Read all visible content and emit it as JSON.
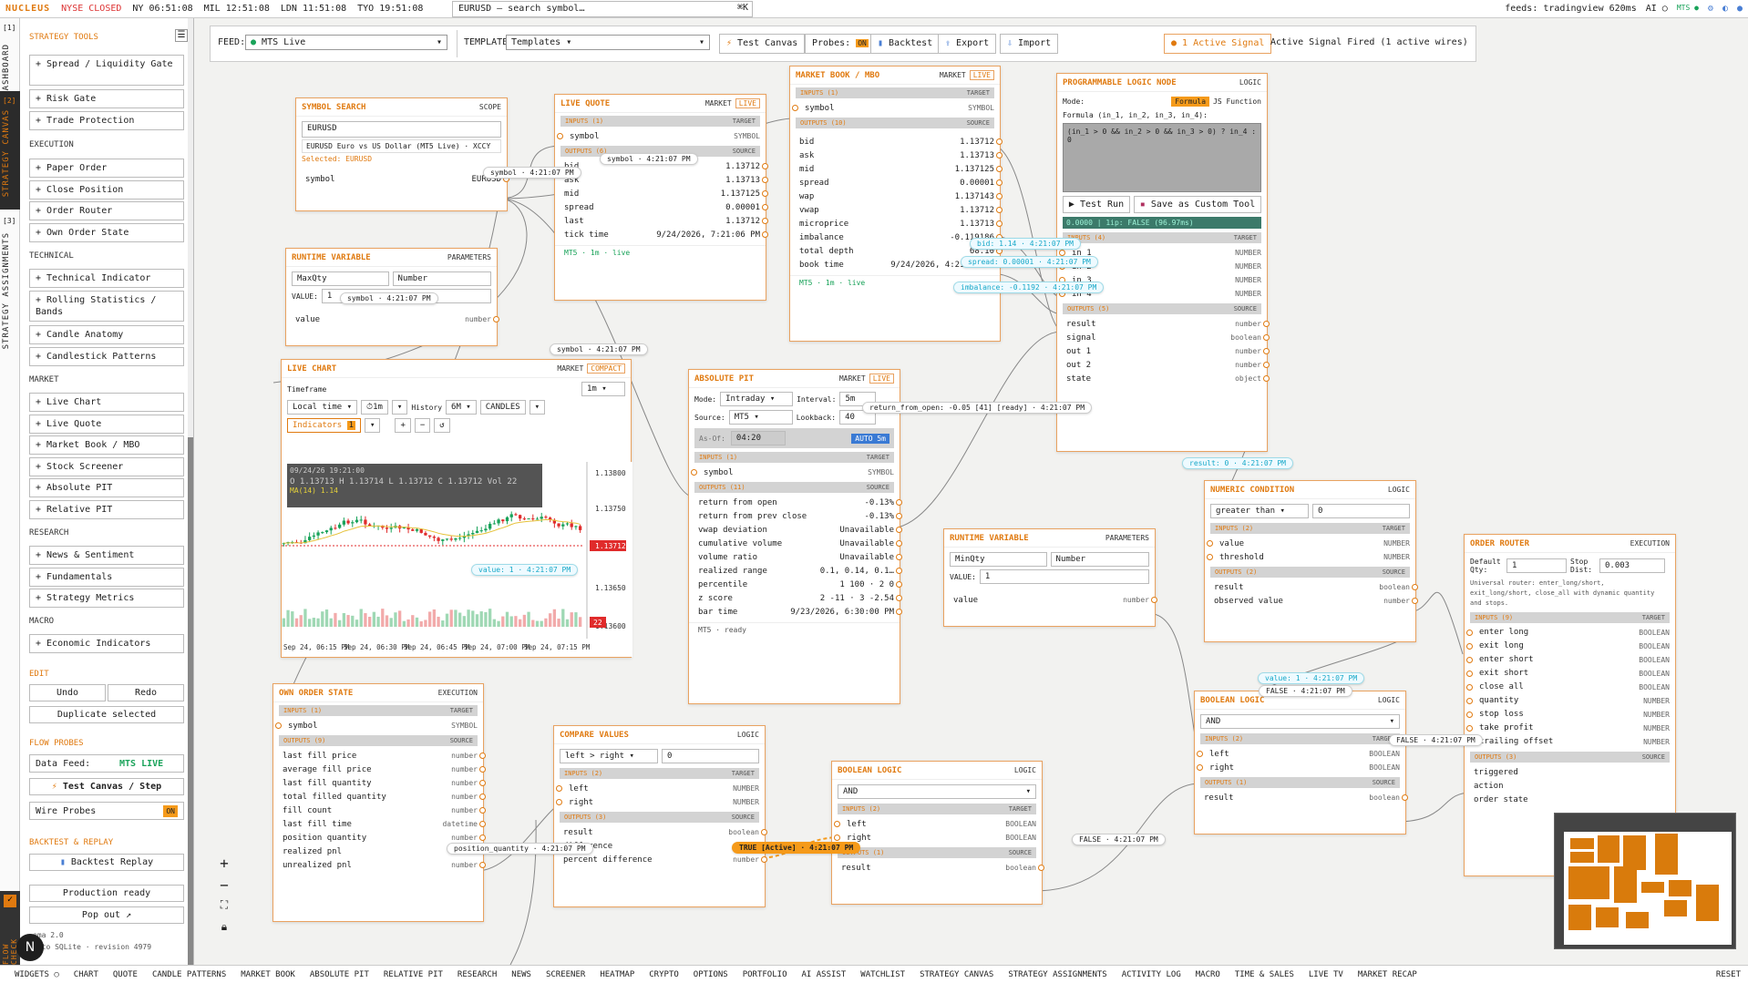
{
  "topbar": {
    "brand": "NUCLEUS",
    "market": "NYSE CLOSED",
    "ny": "NY 06:51:08",
    "mil": "MIL 12:51:08",
    "ldn": "LDN 11:51:08",
    "tyo": "TYO 19:51:08",
    "search": "EURUSD — search symbol…",
    "shortcut": "⌘K",
    "feeds": "feeds: tradingview 620ms",
    "ai": "AI ○",
    "mts": "MTS ●"
  },
  "rail": {
    "n1": "[1]",
    "dashboard": "DASHBOARD",
    "n2": "[2]",
    "canvas": "STRATEGY CANVAS",
    "n3": "[3]",
    "assign": "STRATEGY ASSIGNMENTS",
    "flow": "FLOW CHECK"
  },
  "sidebar": {
    "header": "STRATEGY TOOLS",
    "strategy": [
      "+ Spread / Liquidity Gate",
      "+ Risk Gate",
      "+ Trade Protection"
    ],
    "execution_title": "EXECUTION",
    "execution": [
      "+ Paper Order",
      "+ Close Position",
      "+ Order Router",
      "+ Own Order State"
    ],
    "technical_title": "TECHNICAL",
    "technical": [
      "+ Technical Indicator",
      "+ Rolling Statistics / Bands",
      "+ Candle Anatomy",
      "+ Candlestick Patterns"
    ],
    "market_title": "MARKET",
    "market": [
      "+ Live Chart",
      "+ Live Quote",
      "+ Market Book / MBO",
      "+ Stock Screener",
      "+ Absolute PIT",
      "+ Relative PIT"
    ],
    "research_title": "RESEARCH",
    "research": [
      "+ News & Sentiment",
      "+ Fundamentals",
      "+ Strategy Metrics"
    ],
    "macro_title": "MACRO",
    "macro": [
      "+ Economic Indicators"
    ],
    "edit_title": "EDIT",
    "undo": "Undo",
    "redo": "Redo",
    "dup": "Duplicate selected",
    "probes_title": "FLOW PROBES",
    "data_feed": "Data Feed:",
    "data_feed_val": "MTS LIVE",
    "test": "Test Canvas / Step",
    "wire": "Wire Probes",
    "wire_val": "ON",
    "bt_title": "BACKTEST & REPLAY",
    "bt": "Backtest Replay",
    "prod": "Production ready",
    "pop": "Pop out ↗",
    "schema": "ema 2.0",
    "saved": "d to SQLite · revision 4979"
  },
  "toolbar": {
    "feed_label": "FEED:",
    "feed": "MTS Live",
    "template_label": "TEMPLATE:",
    "template": "Templates ▾",
    "test": "Test Canvas",
    "probes": "Probes:",
    "probes_val": "ON",
    "backtest": "Backtest",
    "export": "Export",
    "import": "Import",
    "signal": "1 Active Signal",
    "signal_text": "Active Signal Fired (1 active wires)"
  },
  "symbol_search": {
    "title": "SYMBOL SEARCH",
    "cat": "SCOPE",
    "input": "EURUSD",
    "result": "EURUSD Euro vs US Dollar (MT5 Live) · XCCY",
    "selected": "Selected: EURUSD",
    "row_l": "symbol",
    "row_r": "EURUSD"
  },
  "rv1": {
    "title": "RUNTIME VARIABLE",
    "cat": "PARAMETERS",
    "name": "MaxQty",
    "type": "Number",
    "value_lbl": "VALUE:",
    "value": "1",
    "row": "value",
    "rtype": "number"
  },
  "live_quote": {
    "title": "LIVE QUOTE",
    "cat": "MARKET",
    "badge": "LIVE",
    "inputs": "INPUTS (1)",
    "target": "TARGET",
    "in_sym": "symbol",
    "in_t": "SYMBOL",
    "outputs": "OUTPUTS (6)",
    "source": "SOURCE",
    "rows": [
      [
        "bid",
        "1.13712"
      ],
      [
        "ask",
        "1.13713"
      ],
      [
        "mid",
        "1.137125"
      ],
      [
        "spread",
        "0.00001"
      ],
      [
        "last",
        "1.13712"
      ],
      [
        "tick time",
        "9/24/2026, 7:21:06 PM"
      ]
    ],
    "foot": "MT5 · 1m · live"
  },
  "book": {
    "title": "MARKET BOOK / MBO",
    "cat": "MARKET",
    "badge": "LIVE",
    "inputs": "INPUTS (1)",
    "in_sym": "symbol",
    "in_t": "SYMBOL",
    "outputs": "OUTPUTS (10)",
    "rows": [
      [
        "bid",
        "1.13712"
      ],
      [
        "ask",
        "1.13713"
      ],
      [
        "mid",
        "1.137125"
      ],
      [
        "spread",
        "0.00001"
      ],
      [
        "wap",
        "1.137143"
      ],
      [
        "vwap",
        "1.13712"
      ],
      [
        "microprice",
        "1.13713"
      ],
      [
        "imbalance",
        "-0.119186"
      ],
      [
        "total depth",
        "68.10"
      ],
      [
        "book time",
        "9/24/2026, 4:21:06 PM"
      ]
    ],
    "foot": "MT5 · 1m · live"
  },
  "logic": {
    "title": "PROGRAMMABLE LOGIC NODE",
    "cat": "LOGIC",
    "mode": "Mode:",
    "formula": "Formula",
    "js": "JS Function",
    "flabel": "Formula (in_1, in_2, in_3, in_4):",
    "code": "(in_1 > 0 && in_2 > 0 && in_3 > 0) ? in_4 : 0",
    "run": "Test Run",
    "save": "Save as Custom Tool",
    "status": "0.0000 | 1ip: FALSE (96.97ms)",
    "inputs": "INPUTS (4)",
    "ins": [
      "in 1",
      "in 2",
      "in 3",
      "in 4"
    ],
    "outputs": "OUTPUTS (5)",
    "outs": [
      [
        "result",
        "number"
      ],
      [
        "signal",
        "boolean"
      ],
      [
        "out 1",
        "number"
      ],
      [
        "out 2",
        "number"
      ],
      [
        "state",
        "object"
      ]
    ]
  },
  "chart": {
    "title": "LIVE CHART",
    "cat": "MARKET",
    "badge": "COMPACT",
    "tf_lbl": "Timeframe",
    "tf": "1m",
    "tz": "Local time",
    "interval": "1m",
    "history_lbl": "History",
    "history": "6M",
    "candles": "CANDLES",
    "ind": "Indicators",
    "ind_n": "1",
    "ohlc_date": "09/24/26 19:21:00",
    "ohlc": "O 1.13713  H 1.13714  L 1.13712  C 1.13712  Vol 22",
    "ma": "MA(14) 1.14",
    "ticks": [
      "1.13800",
      "1.13750",
      "1.13712",
      "1.13650",
      "1.13600"
    ],
    "xticks": [
      "Sep 24, 06:15 PM",
      "Sep 24, 06:30 PM",
      "Sep 24, 06:45 PM",
      "Sep 24, 07:00 PM",
      "Sep 24, 07:15 PM"
    ],
    "vol": "22"
  },
  "pit": {
    "title": "ABSOLUTE PIT",
    "cat": "MARKET",
    "badge": "LIVE",
    "mode_lbl": "Mode:",
    "mode": "Intraday",
    "interval_lbl": "Interval:",
    "interval": "5m",
    "source_lbl": "Source:",
    "source": "MT5",
    "lookback_lbl": "Lookback:",
    "lookback": "40",
    "asof_lbl": "As-Of:",
    "asof": "04:20",
    "auto": "AUTO 5m",
    "inputs": "INPUTS (1)",
    "in_sym": "symbol",
    "in_t": "SYMBOL",
    "outputs": "OUTPUTS (11)",
    "rows": [
      [
        "return from open",
        "-0.13%"
      ],
      [
        "return from prev close",
        "-0.13%"
      ],
      [
        "vwap deviation",
        "Unavailable"
      ],
      [
        "cumulative volume",
        "Unavailable"
      ],
      [
        "volume ratio",
        "Unavailable"
      ],
      [
        "realized range",
        "0.1, 0.14, 0.1…"
      ],
      [
        "percentile",
        "1 100 · 2 0"
      ],
      [
        "z score",
        "2 -11 · 3 -2.54"
      ],
      [
        "bar time",
        "9/23/2026, 6:30:00 PM"
      ]
    ],
    "foot": "MT5 · ready"
  },
  "rv2": {
    "title": "RUNTIME VARIABLE",
    "cat": "PARAMETERS",
    "name": "MinQty",
    "type": "Number",
    "value_lbl": "VALUE:",
    "value": "1",
    "row": "value",
    "rtype": "number"
  },
  "numcond": {
    "title": "NUMERIC CONDITION",
    "cat": "LOGIC",
    "op": "greater than",
    "val": "0",
    "inputs": "INPUTS (2)",
    "ins": [
      [
        "value",
        "NUMBER"
      ],
      [
        "threshold",
        "NUMBER"
      ]
    ],
    "outputs": "OUTPUTS (2)",
    "outs": [
      [
        "result",
        "boolean"
      ],
      [
        "observed value",
        "number"
      ]
    ]
  },
  "router": {
    "title": "ORDER ROUTER",
    "cat": "EXECUTION",
    "qty_lbl": "Default Qty:",
    "qty": "1",
    "stop_lbl": "Stop Dist:",
    "stop": "0.003",
    "desc": "Universal router: enter_long/short, exit_long/short, close_all with dynamic quantity and stops.",
    "inputs": "INPUTS (9)",
    "ins": [
      [
        "enter long",
        "BOOLEAN"
      ],
      [
        "exit long",
        "BOOLEAN"
      ],
      [
        "enter short",
        "BOOLEAN"
      ],
      [
        "exit short",
        "BOOLEAN"
      ],
      [
        "close all",
        "BOOLEAN"
      ],
      [
        "quantity",
        "NUMBER"
      ],
      [
        "stop loss",
        "NUMBER"
      ],
      [
        "take profit",
        "NUMBER"
      ],
      [
        "trailing offset",
        "NUMBER"
      ]
    ],
    "outputs": "OUTPUTS (3)",
    "outs": [
      "triggered",
      "action",
      "order state"
    ]
  },
  "ownorder": {
    "title": "OWN ORDER STATE",
    "cat": "EXECUTION",
    "inputs": "INPUTS (1)",
    "in_sym": "symbol",
    "in_t": "SYMBOL",
    "outputs": "OUTPUTS (9)",
    "rows": [
      [
        "last fill price",
        "number"
      ],
      [
        "average fill price",
        "number"
      ],
      [
        "last fill quantity",
        "number"
      ],
      [
        "total filled quantity",
        "number"
      ],
      [
        "fill count",
        "number"
      ],
      [
        "last fill time",
        "datetime"
      ],
      [
        "position quantity",
        "number"
      ],
      [
        "realized pnl",
        "number"
      ],
      [
        "unrealized pnl",
        "number"
      ]
    ]
  },
  "compare": {
    "title": "COMPARE VALUES",
    "cat": "LOGIC",
    "op": "left > right",
    "val": "0",
    "inputs": "INPUTS (2)",
    "ins": [
      [
        "left",
        "NUMBER"
      ],
      [
        "right",
        "NUMBER"
      ]
    ],
    "outputs": "OUTPUTS (3)",
    "outs": [
      [
        "result",
        "boolean"
      ],
      [
        "difference",
        "number"
      ],
      [
        "percent difference",
        "number"
      ]
    ]
  },
  "bool1": {
    "title": "BOOLEAN LOGIC",
    "cat": "LOGIC",
    "op": "AND",
    "inputs": "INPUTS (2)",
    "ins": [
      [
        "left",
        "BOOLEAN"
      ],
      [
        "right",
        "BOOLEAN"
      ]
    ],
    "outputs": "OUTPUTS (1)",
    "out": "result",
    "out_t": "boolean"
  },
  "bool2": {
    "title": "BOOLEAN LOGIC",
    "cat": "LOGIC",
    "op": "AND",
    "inputs": "INPUTS (2)",
    "ins": [
      [
        "left",
        "BOOLEAN"
      ],
      [
        "right",
        "BOOLEAN"
      ]
    ],
    "outputs": "OUTPUTS (1)",
    "out": "result",
    "out_t": "boolean"
  },
  "tags": {
    "t1": "symbol · 4:21:07 PM",
    "t2": "symbol · 4:21:07 PM",
    "t3": "symbol · 4:21:07 PM",
    "t4": "symbol · 4:21:07 PM",
    "bid": "bid: 1.14 · 4:21:07 PM",
    "spread": "spread: 0.00001 · 4:21:07 PM",
    "imb": "imbalance: -0.1192 · 4:21:07 PM",
    "ret": "return_from_open: -0.05 [41] [ready] · 4:21:07 PM",
    "res": "result: 0 · 4:21:07 PM",
    "val1": "value: 1 · 4:21:07 PM",
    "val2": "value: 1 · 4:21:07 PM",
    "f1": "FALSE · 4:21:07 PM",
    "f2": "FALSE · 4:21:07 PM",
    "f3": "FALSE · 4:21:07 PM",
    "pos": "position_quantity · 4:21:07 PM",
    "true": "TRUE [Active] · 4:21:07 PM"
  },
  "bottom": {
    "widgets": "WIDGETS ○",
    "items": [
      "CHART",
      "QUOTE",
      "CANDLE PATTERNS",
      "MARKET BOOK",
      "ABSOLUTE PIT",
      "RELATIVE PIT",
      "RESEARCH",
      "NEWS",
      "SCREENER",
      "HEATMAP",
      "CRYPTO",
      "OPTIONS",
      "PORTFOLIO",
      "AI ASSIST",
      "WATCHLIST",
      "STRATEGY CANVAS",
      "STRATEGY ASSIGNMENTS",
      "ACTIVITY LOG",
      "MACRO",
      "TIME & SALES",
      "LIVE TV",
      "MARKET RECAP"
    ],
    "reset": "RESET"
  },
  "colors": {
    "accent": "#e07a10",
    "live": "#1aa35a",
    "probe": "#17a8c8",
    "bear": "#e02b2b",
    "bull": "#1aa35a"
  }
}
